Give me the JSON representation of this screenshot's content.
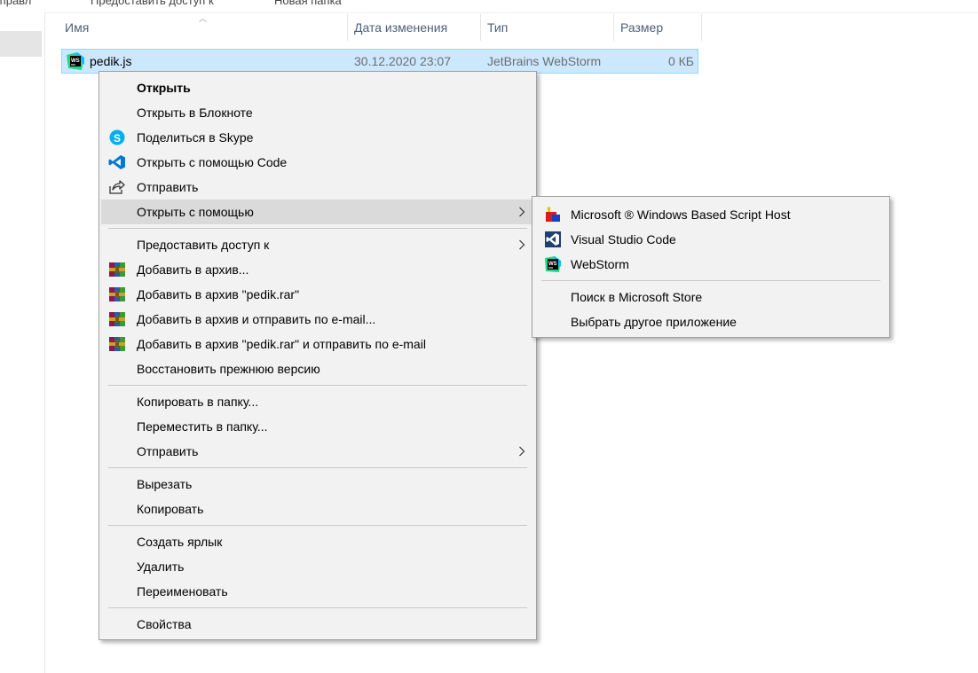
{
  "toolbar": {
    "item_left": "Управл",
    "item_share": "Предоставить доступ к",
    "item_new_folder": "Новая папка"
  },
  "columns": {
    "name": "Имя",
    "modified": "Дата изменения",
    "type": "Тип",
    "size": "Размер"
  },
  "file": {
    "name": "pedik.js",
    "modified": "30.12.2020 23:07",
    "type": "JetBrains WebStorm",
    "size": "0 КБ"
  },
  "context_menu": {
    "open": "Открыть",
    "open_notepad": "Открыть в Блокноте",
    "share_skype": "Поделиться в Skype",
    "open_code": "Открыть с помощью Code",
    "send": "Отправить",
    "open_with": "Открыть с помощью",
    "grant_access": "Предоставить доступ к",
    "add_archive": "Добавить в архив...",
    "add_archive_named": "Добавить в архив \"pedik.rar\"",
    "add_archive_email": "Добавить в архив и отправить по e-mail...",
    "add_archive_named_email": "Добавить в архив \"pedik.rar\" и отправить по e-mail",
    "restore_version": "Восстановить прежнюю версию",
    "copy_to": "Копировать в папку...",
    "move_to": "Переместить в папку...",
    "send_to": "Отправить",
    "cut": "Вырезать",
    "copy": "Копировать",
    "create_shortcut": "Создать ярлык",
    "delete": "Удалить",
    "rename": "Переименовать",
    "properties": "Свойства"
  },
  "open_with_submenu": {
    "script_host": "Microsoft ® Windows Based Script Host",
    "vscode": "Visual Studio Code",
    "webstorm": "WebStorm",
    "store_search": "Поиск в Microsoft Store",
    "choose_other": "Выбрать другое приложение"
  },
  "colors": {
    "selection": "#cce8ff",
    "menu_bg": "#f2f2f2",
    "menu_highlight": "#dadada",
    "header_text": "#4c607a"
  }
}
